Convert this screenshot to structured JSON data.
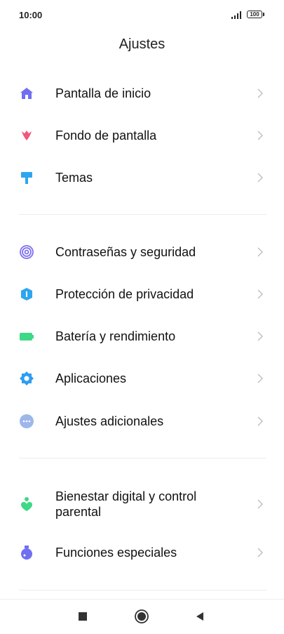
{
  "status": {
    "time": "10:00",
    "battery": "100"
  },
  "header": {
    "title": "Ajustes"
  },
  "groups": [
    {
      "items": [
        {
          "label": "Pantalla de inicio",
          "icon": "home-icon"
        },
        {
          "label": "Fondo de pantalla",
          "icon": "tulip-icon"
        },
        {
          "label": "Temas",
          "icon": "paint-roller-icon"
        }
      ]
    },
    {
      "items": [
        {
          "label": "Contraseñas y seguridad",
          "icon": "fingerprint-icon"
        },
        {
          "label": "Protección de privacidad",
          "icon": "privacy-shield-icon"
        },
        {
          "label": "Batería y rendimiento",
          "icon": "battery-icon"
        },
        {
          "label": "Aplicaciones",
          "icon": "gear-icon"
        },
        {
          "label": "Ajustes adicionales",
          "icon": "more-dots-icon"
        }
      ]
    },
    {
      "items": [
        {
          "label": "Bienestar digital y control parental",
          "icon": "wellbeing-icon"
        },
        {
          "label": "Funciones especiales",
          "icon": "special-features-icon"
        }
      ]
    }
  ],
  "colors": {
    "home": "#6f6ff2",
    "tulip": "#f2567a",
    "roller": "#2ea6ef",
    "fingerprint": "#7c6ff0",
    "privacy": "#2ea6ef",
    "battery": "#3ed886",
    "gear": "#2e9ef0",
    "dots": "#9db7ea",
    "wellbeing": "#3ed886",
    "special": "#6f6ff2",
    "chevron": "#bdbdbd"
  }
}
